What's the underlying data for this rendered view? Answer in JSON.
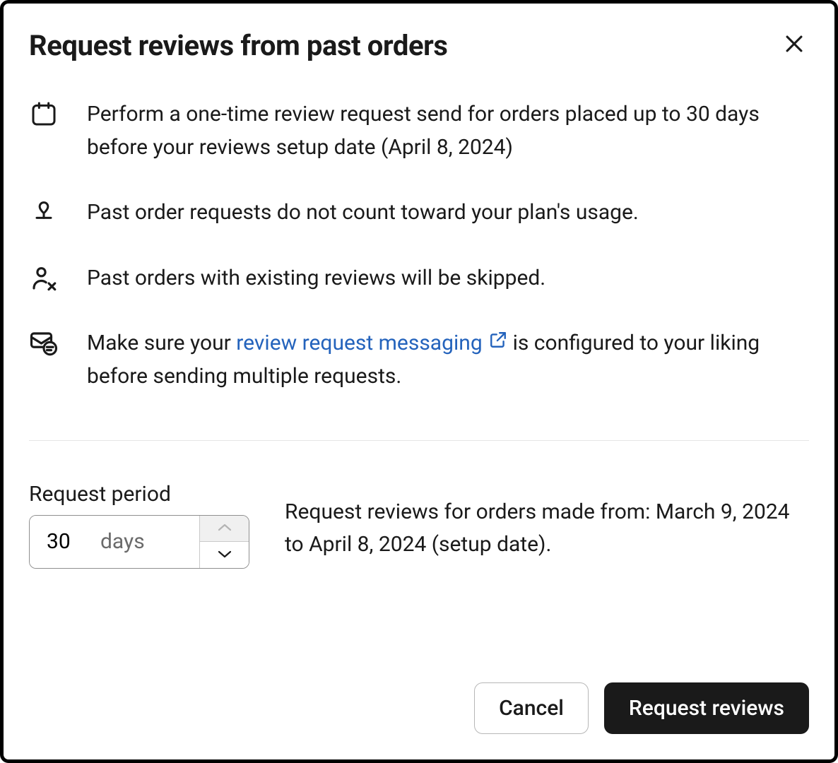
{
  "modal": {
    "title": "Request reviews from past orders"
  },
  "bullets": {
    "b0": "Perform a one-time review request send for orders placed up to 30 days before your reviews setup date (April 8, 2024)",
    "b1": "Past order requests do not count toward your plan's usage.",
    "b2": "Past orders with existing reviews will be skipped.",
    "b3_pre": "Make sure your ",
    "b3_link": "review request messaging",
    "b3_post": " is configured to your liking before sending multiple requests."
  },
  "period": {
    "label": "Request period",
    "value": "30",
    "unit": "days"
  },
  "range": {
    "text": "Request reviews for orders made from: March 9, 2024 to April 8, 2024 (setup date)."
  },
  "actions": {
    "cancel": "Cancel",
    "submit": "Request reviews"
  }
}
